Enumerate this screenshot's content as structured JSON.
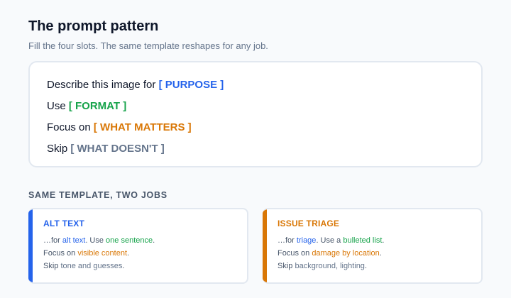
{
  "header": {
    "title": "The prompt pattern",
    "subtitle": "Fill the four slots. The same template reshapes for any job."
  },
  "template": {
    "line1_prefix": "Describe this image for ",
    "line1_slot": "[ PURPOSE ]",
    "line2_prefix": "Use ",
    "line2_slot": "[ FORMAT ]",
    "line3_prefix": "Focus on ",
    "line3_slot": "[ WHAT MATTERS ]",
    "line4_prefix": "Skip ",
    "line4_slot": "[ WHAT DOESN'T ]"
  },
  "section_label": "SAME TEMPLATE, TWO JOBS",
  "jobs": [
    {
      "title": "ALT TEXT",
      "purpose_prefix": "…for ",
      "purpose": "alt text",
      "format_prefix": ". Use ",
      "format": "one sentence",
      "format_suffix": ".",
      "focus_prefix": "Focus on ",
      "focus": "visible content",
      "focus_suffix": ".",
      "skip_prefix": "Skip ",
      "skip": "tone and guesses",
      "skip_suffix": "."
    },
    {
      "title": "ISSUE TRIAGE",
      "purpose_prefix": "…for ",
      "purpose": "triage",
      "format_prefix": ". Use a ",
      "format": "bulleted list",
      "format_suffix": ".",
      "focus_prefix": "Focus on ",
      "focus": "damage by location",
      "focus_suffix": ".",
      "skip_prefix": "Skip ",
      "skip": "background, lighting",
      "skip_suffix": "."
    }
  ],
  "colors": {
    "purpose": "#2563eb",
    "format": "#16a34a",
    "focus": "#d97706",
    "skip": "#64748b",
    "alt_text_accent": "#2563eb",
    "issue_triage_accent": "#d97706"
  }
}
